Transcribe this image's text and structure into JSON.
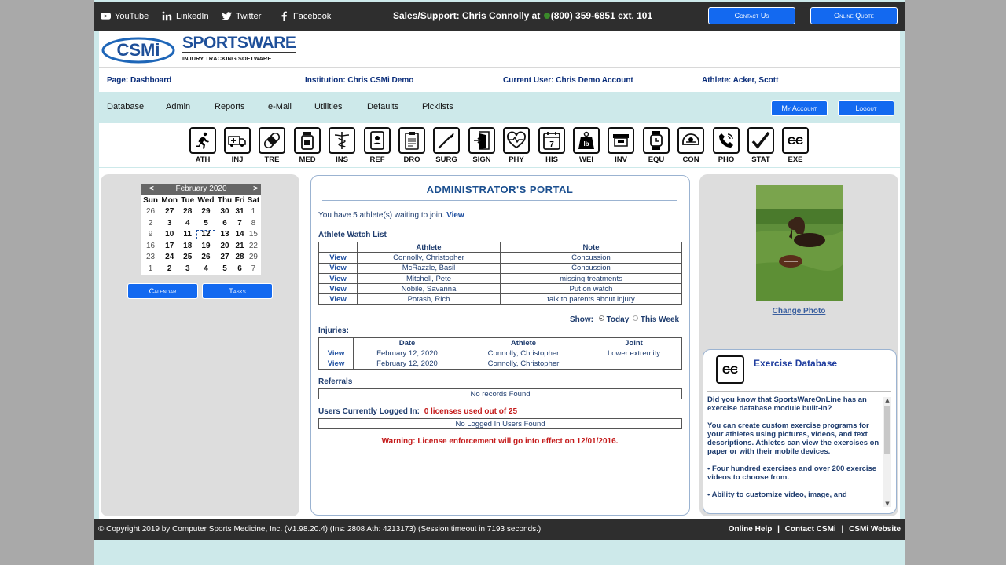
{
  "topbar": {
    "social": [
      "YouTube",
      "LinkedIn",
      "Twitter",
      "Facebook"
    ],
    "sales_label": "Sales/Support: Chris Connolly at",
    "sales_phone": "(800) 359-6851 ext. 101",
    "contact_button": "Contact Us",
    "quote_button": "Online Quote"
  },
  "logo": {
    "brand": "CSMi",
    "product": "SPORTSWARE",
    "tagline": "INJURY TRACKING SOFTWARE"
  },
  "info": {
    "page": "Page: Dashboard",
    "institution": "Institution: Chris CSMi Demo",
    "user": "Current User: Chris Demo Account",
    "athlete": "Athlete: Acker, Scott"
  },
  "menu": {
    "items": [
      "Database",
      "Admin",
      "Reports",
      "e-Mail",
      "Utilities",
      "Defaults",
      "Picklists"
    ],
    "my_account": "My Account",
    "logout": "Logout"
  },
  "tools": [
    {
      "label": "ATH",
      "icon": "runner-icon"
    },
    {
      "label": "INJ",
      "icon": "ambulance-icon"
    },
    {
      "label": "TRE",
      "icon": "bandage-icon"
    },
    {
      "label": "MED",
      "icon": "medicine-bottle-icon"
    },
    {
      "label": "INS",
      "icon": "caduceus-icon"
    },
    {
      "label": "REF",
      "icon": "id-card-icon"
    },
    {
      "label": "DRO",
      "icon": "clipboard-icon"
    },
    {
      "label": "SURG",
      "icon": "scalpel-icon"
    },
    {
      "label": "SIGN",
      "icon": "door-icon"
    },
    {
      "label": "PHY",
      "icon": "heartbeat-icon"
    },
    {
      "label": "HIS",
      "icon": "calendar-7-icon"
    },
    {
      "label": "WEI",
      "icon": "weight-icon"
    },
    {
      "label": "INV",
      "icon": "inventory-icon"
    },
    {
      "label": "EQU",
      "icon": "watch-icon"
    },
    {
      "label": "CON",
      "icon": "helmet-icon"
    },
    {
      "label": "PHO",
      "icon": "phone-icon"
    },
    {
      "label": "STAT",
      "icon": "checkmark-icon"
    },
    {
      "label": "EXE",
      "icon": "exercise-icon"
    }
  ],
  "calendar": {
    "month": "February 2020",
    "prev": "<",
    "next": ">",
    "days": [
      "Sun",
      "Mon",
      "Tue",
      "Wed",
      "Thu",
      "Fri",
      "Sat"
    ],
    "weeks": [
      [
        "26",
        "27",
        "28",
        "29",
        "30",
        "31",
        "1"
      ],
      [
        "2",
        "3",
        "4",
        "5",
        "6",
        "7",
        "8"
      ],
      [
        "9",
        "10",
        "11",
        "12",
        "13",
        "14",
        "15"
      ],
      [
        "16",
        "17",
        "18",
        "19",
        "20",
        "21",
        "22"
      ],
      [
        "23",
        "24",
        "25",
        "26",
        "27",
        "28",
        "29"
      ],
      [
        "1",
        "2",
        "3",
        "4",
        "5",
        "6",
        "7"
      ]
    ],
    "today": "12",
    "calendar_button": "Calendar",
    "tasks_button": "Tasks"
  },
  "portal": {
    "title": "ADMINISTRATOR'S PORTAL",
    "waiting_text": "You have 5 athlete(s) waiting to join.",
    "waiting_link": "View",
    "watch_title": "Athlete Watch List",
    "watch_headers": [
      "",
      "Athlete",
      "Note"
    ],
    "watch_rows": [
      {
        "link": "View",
        "athlete": "Connolly, Christopher",
        "note": "Concussion"
      },
      {
        "link": "View",
        "athlete": "McRazzle, Basil",
        "note": "Concussion"
      },
      {
        "link": "View",
        "athlete": "Mitchell, Pete",
        "note": "missing treatments"
      },
      {
        "link": "View",
        "athlete": "Nobile, Savanna",
        "note": "Put on watch"
      },
      {
        "link": "View",
        "athlete": "Potash, Rich",
        "note": "talk to parents about injury"
      }
    ],
    "show_label": "Show:",
    "show_today": "Today",
    "show_week": "This Week",
    "injuries_title": "Injuries:",
    "injury_headers": [
      "",
      "Date",
      "Athlete",
      "Joint"
    ],
    "injury_rows": [
      {
        "link": "View",
        "date": "February 12, 2020",
        "athlete": "Connolly, Christopher",
        "joint": "Lower extremity"
      },
      {
        "link": "View",
        "date": "February 12, 2020",
        "athlete": "Connolly, Christopher",
        "joint": ""
      }
    ],
    "referrals_title": "Referrals",
    "referrals_empty": "No records Found",
    "logged_title": "Users Currently Logged In:",
    "licenses": "0 licenses used out of 25",
    "logged_empty": "No Logged In Users Found",
    "warning": "Warning: License enforcement will go into effect on 12/01/2016."
  },
  "right": {
    "change_photo": "Change Photo",
    "exercise_title": "Exercise Database",
    "exercise_paragraphs": [
      "Did you know that SportsWareOnLine has an exercise database module built-in?",
      "You can create custom exercise programs for your athletes using pictures, videos, and text descriptions. Athletes can view the exercises on paper or with their mobile devices.",
      "• Four hundred exercises and over 200 exercise videos to choose from.",
      "• Ability to customize video, image, and"
    ]
  },
  "footer": {
    "copyright": "© Copyright 2019 by Computer Sports Medicine, Inc. (V1.98.20.4) (Ins: 2808 Ath: 4213173) (Session timeout in 7193 seconds.)",
    "links": [
      "Online Help",
      "Contact CSMi",
      "CSMi Website"
    ]
  }
}
